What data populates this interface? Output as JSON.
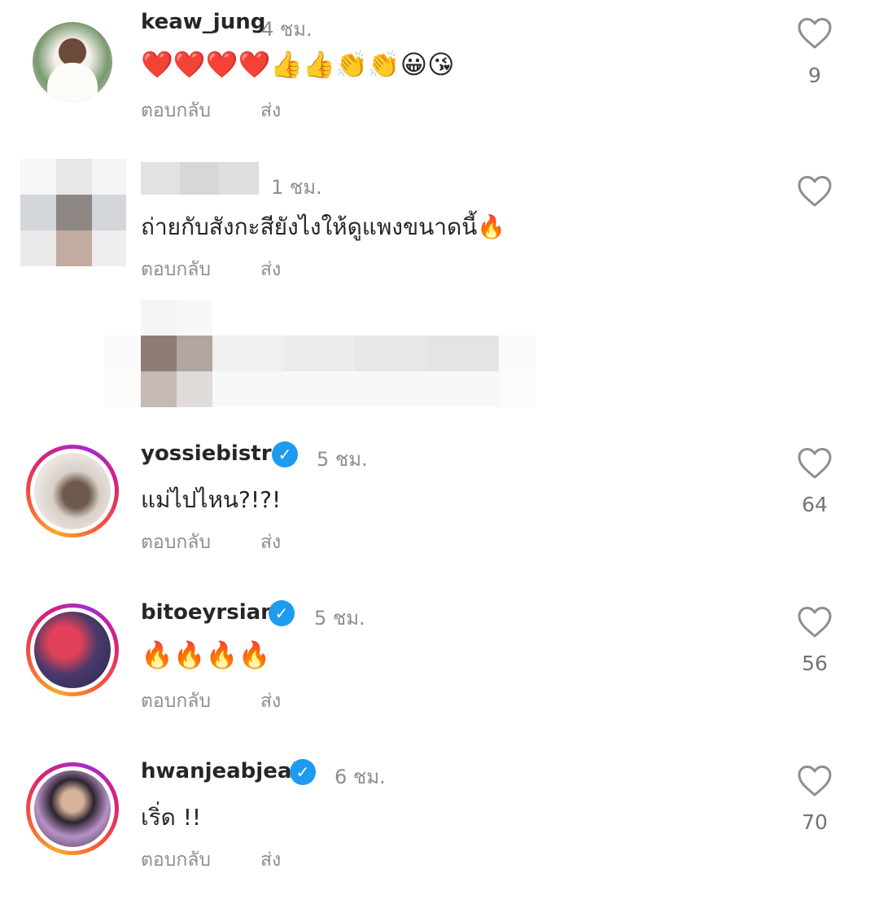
{
  "comments": [
    {
      "username": "keaw_jung",
      "time": "4 ชม.",
      "text": "❤️❤️❤️❤️👍👍👏👏😀😘",
      "likes": "9",
      "verified": false
    },
    {
      "username": "",
      "time": "1 ชม.",
      "text": "ถ่ายกับสังกะสียังไงให้ดูแพงขนาดนี้🔥",
      "likes": "",
      "verified": false
    },
    {
      "username": "yossiebistro",
      "time": "5 ชม.",
      "text": "แม่ไปไหน?!?!",
      "likes": "64",
      "verified": true
    },
    {
      "username": "bitoeyrsiam",
      "time": "5 ชม.",
      "text": "🔥🔥🔥🔥",
      "likes": "56",
      "verified": true
    },
    {
      "username": "hwanjeabjeab",
      "time": "6 ชม.",
      "text": "เริ่ด !!",
      "likes": "70",
      "verified": true
    }
  ],
  "actions": {
    "reply_label": "ตอบกลับ",
    "send_label": "ส่ง"
  },
  "icons": {
    "like": "heart-outline-icon",
    "verified": "verified-badge-icon"
  },
  "colors": {
    "verified": "#1d9bf0",
    "secondary_text": "#8e8e8e",
    "story_ring": [
      "#f9a825",
      "#f5533d",
      "#d8207a",
      "#a32bd1"
    ]
  }
}
